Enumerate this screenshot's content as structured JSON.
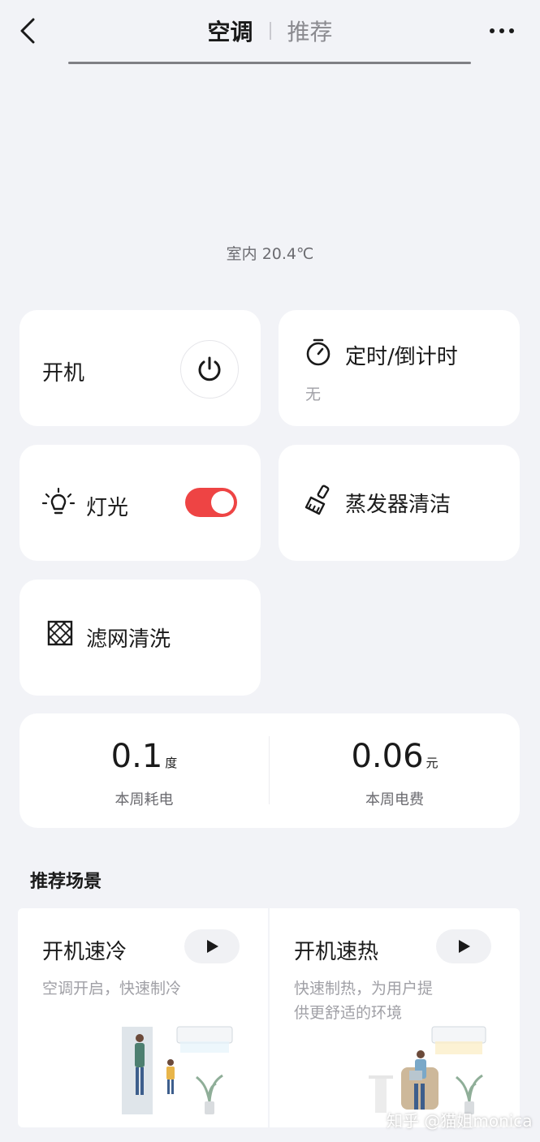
{
  "header": {
    "active_tab": "空调",
    "tab_recommend": "推荐"
  },
  "indoor_temp": "室内 20.4℃",
  "controls": {
    "power_label": "开机",
    "timer_label": "定时/倒计时",
    "timer_value": "无",
    "light_label": "灯光",
    "light_on": true,
    "evaporator_label": "蒸发器清洁",
    "filter_label": "滤网清洗"
  },
  "stats": {
    "energy_value": "0.1",
    "energy_unit": "度",
    "energy_caption": "本周耗电",
    "cost_value": "0.06",
    "cost_unit": "元",
    "cost_caption": "本周电费"
  },
  "scenes_section_title": "推荐场景",
  "scenes": [
    {
      "title": "开机速冷",
      "desc_line1": "空调开启，快速制冷",
      "desc_line2": ""
    },
    {
      "title": "开机速热",
      "desc_line1": "快速制热，为用户提",
      "desc_line2": "供更舒适的环境"
    }
  ],
  "watermark": "知乎 @猫姐monica",
  "colors": {
    "background": "#f2f3f7",
    "card": "#ffffff",
    "toggle_on": "#ee4444"
  },
  "icons": [
    "back-arrow-icon",
    "more-icon",
    "power-icon",
    "stopwatch-icon",
    "bulb-icon",
    "brush-icon",
    "filter-icon",
    "play-icon"
  ]
}
